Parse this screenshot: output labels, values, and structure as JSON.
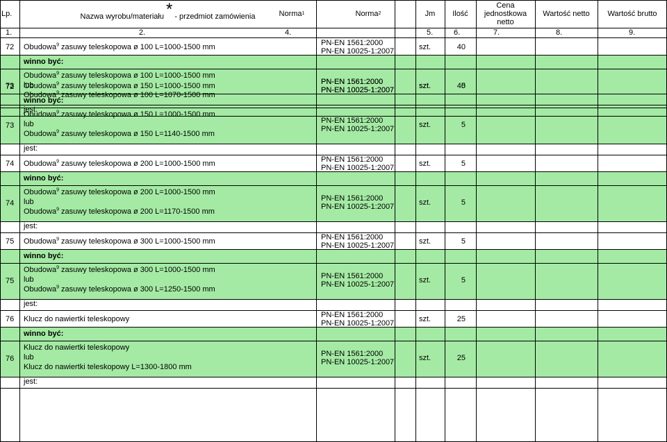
{
  "header": {
    "lp": "Lp.",
    "name_star": "*",
    "name_text": "Nazwa wyrobu/materiału",
    "name_suffix": "- przedmiot zamówienia",
    "norma1": "Norma",
    "norma1_sup": "1",
    "norma2": "Norma",
    "norma2_sup": "2",
    "jm": "Jm",
    "ilosc": "Ilość",
    "cena": "Cena jednostkowa netto",
    "wartosc_netto": "Wartość netto",
    "wartosc_brutto": "Wartość brutto"
  },
  "numbering": [
    "1.",
    "2.",
    "4.",
    "5.",
    "6.",
    "7.",
    "8.",
    "9."
  ],
  "labels": {
    "winno": "winno być:",
    "jest": "jest:",
    "lub": "lub"
  },
  "norms": [
    "PN-EN 1561:2000",
    "PN-EN 10025-1:2007"
  ],
  "unit": "szt.",
  "groups": [
    {
      "lp": "72",
      "item": "Obudowa",
      "item_sup": "9",
      "item_rest": "zasuwy teleskopowa ø 100  L=1000-1500 mm",
      "qty": "40",
      "winno_1": "zasuwy teleskopowa ø 100  L=1000-1500 mm",
      "winno_2": "zasuwy teleskopowa ø 100  L=1070-1500 mm"
    },
    {
      "lp": "73",
      "item": "Obudowa",
      "item_sup": "9",
      "item_rest": "zasuwy teleskopowa ø 150  L=1000-1500 mm",
      "qty": "5",
      "winno_1": "zasuwy teleskopowa ø 150  L=1000-1500 mm",
      "winno_2": "zasuwy teleskopowa ø 150  L=1140-1500 mm"
    },
    {
      "lp": "74",
      "item": "Obudowa",
      "item_sup": "9",
      "item_rest": "zasuwy teleskopowa ø 200  L=1000-1500 mm",
      "qty": "5",
      "winno_1": "zasuwy teleskopowa ø 200  L=1000-1500 mm",
      "winno_2": "zasuwy teleskopowa ø 200  L=1170-1500 mm"
    },
    {
      "lp": "75",
      "item": "Obudowa",
      "item_sup": "9",
      "item_rest": "zasuwy teleskopowa ø 300  L=1000-1500 mm",
      "qty": "5",
      "winno_1": "zasuwy teleskopowa ø 300  L=1000-1500 mm",
      "winno_2": "zasuwy teleskopowa ø 300  L=1250-1500 mm"
    },
    {
      "lp": "76",
      "item": "Klucz do nawiertki teleskopowy",
      "item_sup": "",
      "item_rest": "",
      "qty": "25",
      "winno_1": "",
      "winno_2": "L=1300-1800 mm"
    }
  ]
}
